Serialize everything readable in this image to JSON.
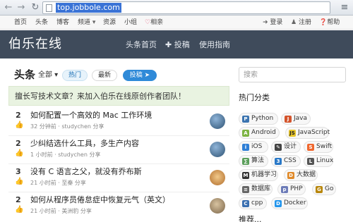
{
  "browser": {
    "url": "top.jobbole.com",
    "back_icon": "arrow-left-icon",
    "forward_icon": "arrow-right-icon",
    "reload_icon": "reload-icon",
    "bookmark_icon": "star-icon",
    "menu_icon": "menu-icon"
  },
  "topnav": {
    "items": [
      "首页",
      "头条",
      "博客",
      "频道",
      "资源",
      "小组",
      "相亲"
    ],
    "login": "登录",
    "register": "注册",
    "help": "帮助"
  },
  "header": {
    "logo": "伯乐在线",
    "nav_home": "头条首页",
    "nav_submit": "投稿",
    "nav_guide": "使用指南",
    "bg_color": "#3f4b5b"
  },
  "feed": {
    "title": "头条",
    "filter_all": "全部",
    "tab_hot": "热门",
    "tab_latest": "最新",
    "submit_button": "投稿",
    "banner": "擅长写技术文章？来加入伯乐在线原创作者团队！",
    "posts": [
      {
        "count": "2",
        "title": "如何配置一个高效的 Mac 工作环境",
        "meta": "32 分钟前 · studychen 分享"
      },
      {
        "count": "2",
        "title": "少纠结选什么工具，多生产内容",
        "meta": "1 小时前 · studychen 分享"
      },
      {
        "count": "3",
        "title": "没有 C 语言之父，就没有乔布斯",
        "meta": "21 小时前 · 至秦 分享"
      },
      {
        "count": "2",
        "title": "如何从程序员倦怠症中恢复元气（英文）",
        "meta": "21 小时前 · 美洲豹 分享"
      }
    ]
  },
  "sidebar": {
    "search_placeholder": "搜索",
    "hot_title": "热门分类",
    "tags": [
      "Python",
      "Java",
      "Android",
      "JavaScript",
      "iOS",
      "设计",
      "Swift",
      "算法",
      "CSS",
      "Linux",
      "机器学习",
      "大数据",
      "数据库",
      "PHP",
      "Go",
      "cpp",
      "Docker"
    ],
    "bottom_cut": "推荐..."
  }
}
